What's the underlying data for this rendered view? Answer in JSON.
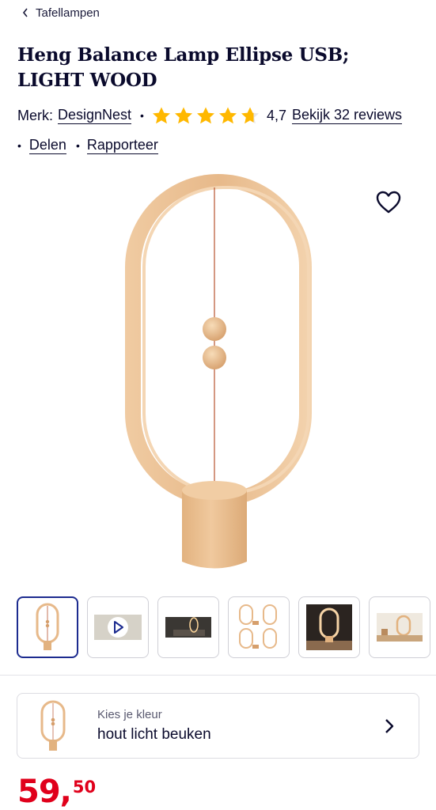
{
  "breadcrumb": {
    "label": "Tafellampen",
    "icon": "chevron-left-icon"
  },
  "product": {
    "title_line1": "Heng Balance Lamp Ellipse USB;",
    "title_line2": "LIGHT WOOD",
    "brand_prefix": "Merk:",
    "brand": "DesignNest",
    "rating_value": "4,7",
    "rating_stars": 4.7,
    "rating_max": 5,
    "reviews_link": "Bekijk 32 reviews",
    "separator": "•"
  },
  "actions": {
    "share": "Delen",
    "report": "Rapporteer",
    "separator": "•"
  },
  "gallery": {
    "wishlist_icon": "heart-outline-icon",
    "thumbnails": [
      {
        "kind": "lamp-front",
        "active": true
      },
      {
        "kind": "video",
        "icon": "play-icon"
      },
      {
        "kind": "lamp-dark-room"
      },
      {
        "kind": "lamp-grid"
      },
      {
        "kind": "lamp-dark-table"
      },
      {
        "kind": "lamp-desk"
      }
    ]
  },
  "variant": {
    "label": "Kies je kleur",
    "value": "hout licht beuken",
    "icon": "chevron-right-icon"
  },
  "price": {
    "whole": "59,",
    "cents": "50"
  },
  "colors": {
    "star": "#ffb800",
    "price": "#e0001b",
    "accent": "#1c2b8f",
    "text": "#0a0a2c",
    "wood": "#e9bf93"
  }
}
